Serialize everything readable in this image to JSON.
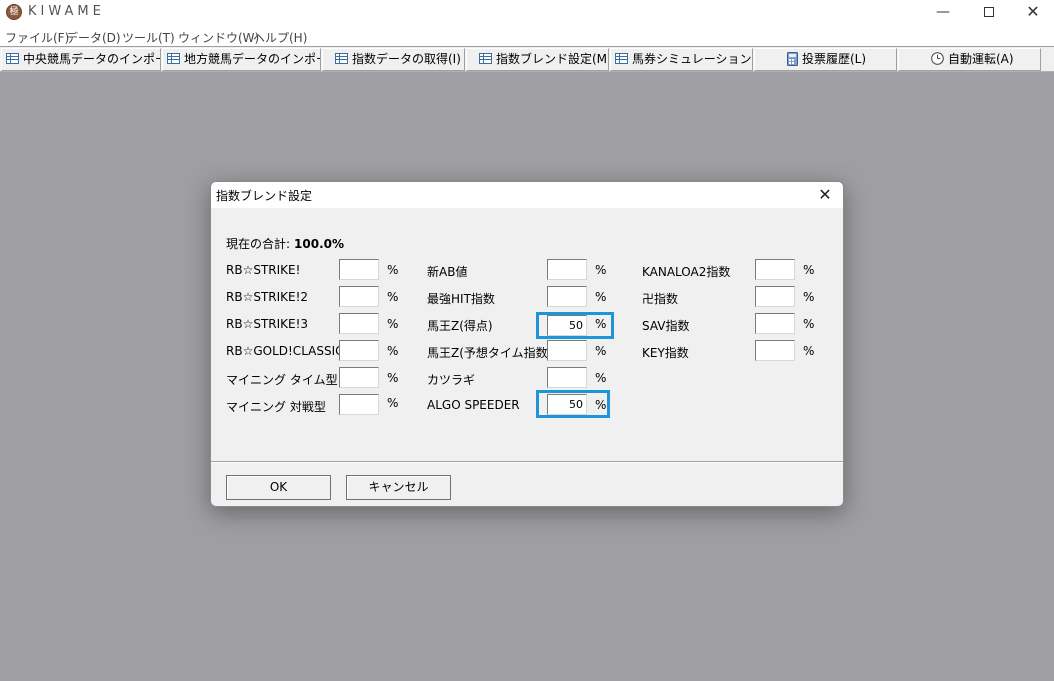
{
  "app": {
    "title": "KIWAME",
    "logo": "kiwame-logo",
    "win_min": "—",
    "win_close": "✕"
  },
  "menu": [
    "ファイル(F)",
    "データ(D)",
    "ツール(T)",
    "ウィンドウ(W)",
    "ヘルプ(H)"
  ],
  "toolbar": [
    {
      "label": "中央競馬データのインポート(J)",
      "icon": "table-icon"
    },
    {
      "label": "地方競馬データのインポート(N)",
      "icon": "table-icon"
    },
    {
      "label": "指数データの取得(I)",
      "icon": "table-icon"
    },
    {
      "label": "指数ブレンド設定(M)",
      "icon": "table-icon"
    },
    {
      "label": "馬券シミュレーション(B)",
      "icon": "table-icon"
    },
    {
      "label": "投票履歴(L)",
      "icon": "calculator-icon"
    },
    {
      "label": "自動運転(A)",
      "icon": "clock-icon"
    }
  ],
  "dialog": {
    "title": "指数ブレンド設定",
    "close": "✕",
    "sum_label": "現在の合計:",
    "sum_value": "100.0%",
    "pct": "%",
    "col1": [
      {
        "label": "RB☆STRIKE!",
        "value": ""
      },
      {
        "label": "RB☆STRIKE!2",
        "value": ""
      },
      {
        "label": "RB☆STRIKE!3",
        "value": ""
      },
      {
        "label": "RB☆GOLD!CLASSIC",
        "value": ""
      },
      {
        "label": "マイニング タイム型",
        "value": ""
      },
      {
        "label": "マイニング 対戦型",
        "value": ""
      }
    ],
    "col2": [
      {
        "label": "新AB値",
        "value": ""
      },
      {
        "label": "最強HIT指数",
        "value": ""
      },
      {
        "label": "馬王Z(得点)",
        "value": "50"
      },
      {
        "label": "馬王Z(予想タイム指数)",
        "value": ""
      },
      {
        "label": "カツラギ",
        "value": ""
      },
      {
        "label": "ALGO SPEEDER",
        "value": "50"
      }
    ],
    "col3": [
      {
        "label": "KANALOA2指数",
        "value": ""
      },
      {
        "label": "卍指数",
        "value": ""
      },
      {
        "label": "SAV指数",
        "value": ""
      },
      {
        "label": "KEY指数",
        "value": ""
      }
    ],
    "ok": "OK",
    "cancel": "キャンセル"
  },
  "colors": {
    "highlight": "#1e96d6",
    "background": "#9e9ea3"
  }
}
